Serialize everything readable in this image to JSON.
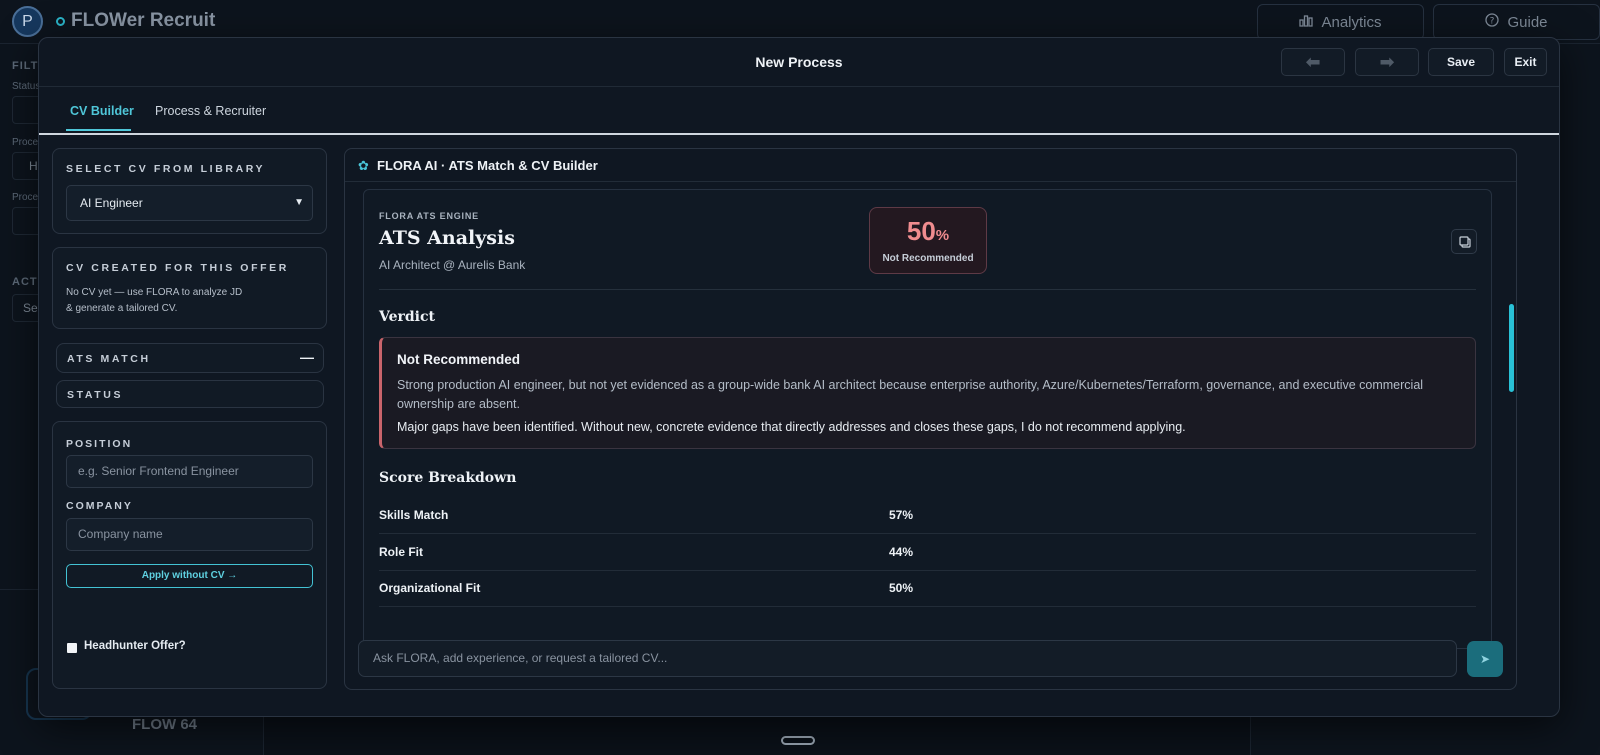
{
  "app": {
    "avatar_letter": "P",
    "title": "FLOWer Recruit",
    "analytics_label": "Analytics",
    "guide_label": "Guide",
    "sidebar_filters_label": "FILTE",
    "sidebar_status_label": "Status",
    "sidebar_proc1_label": "Proce",
    "sidebar_proc1_value": "H",
    "sidebar_proc2_label": "Proce",
    "sidebar_actions_label": "ACTI",
    "sidebar_actions_value": "Se",
    "brand_footer": "FLOW 64"
  },
  "modal": {
    "title": "New Process",
    "prev_icon": "⬅",
    "next_icon": "➡",
    "save_label": "Save",
    "exit_label": "Exit",
    "tabs": [
      {
        "label": "CV Builder",
        "active": true
      },
      {
        "label": "Process & Recruiter",
        "active": false
      }
    ]
  },
  "left": {
    "select_cv_label": "SELECT CV FROM LIBRARY",
    "select_cv_value": "AI Engineer",
    "cv_created_label": "CV CREATED FOR THIS OFFER",
    "cv_created_text_1": "No CV yet — use FLORA to analyze JD",
    "cv_created_text_2": "& generate a tailored CV.",
    "ats_match_label": "ATS MATCH",
    "ats_match_toggle": "—",
    "status_label": "STATUS",
    "position_label": "POSITION",
    "position_placeholder": "e.g. Senior Frontend Engineer",
    "company_label": "COMPANY",
    "company_placeholder": "Company name",
    "apply_button": "Apply without CV →",
    "headhunter_label": "Headhunter Offer?"
  },
  "flora": {
    "icon": "✿",
    "title": "FLORA AI · ATS Match & CV Builder",
    "engine_label": "FLORA ATS ENGINE",
    "analysis_title": "ATS Analysis",
    "subtitle": "AI Architect @ Aurelis Bank",
    "score": "50",
    "score_unit": "%",
    "score_label": "Not Recommended",
    "verdict_heading": "Verdict",
    "verdict_title": "Not Recommended",
    "verdict_text": "Strong production AI engineer, but not yet evidenced as a group-wide bank AI architect because enterprise authority, Azure/Kubernetes/Terraform, governance, and executive commercial ownership are absent.",
    "verdict_text_2": "Major gaps have been identified. Without new, concrete evidence that directly addresses and closes these gaps, I do not recommend applying.",
    "breakdown_heading": "Score Breakdown",
    "breakdown": [
      {
        "label": "Skills Match",
        "value": "57%"
      },
      {
        "label": "Role Fit",
        "value": "44%"
      },
      {
        "label": "Organizational Fit",
        "value": "50%"
      }
    ],
    "chat_placeholder": "Ask FLORA, add experience, or request a tailored CV...",
    "send_icon": "➤"
  },
  "colors": {
    "accent": "#4fc6d8",
    "danger": "#f08c8f",
    "background": "#0b1119"
  }
}
